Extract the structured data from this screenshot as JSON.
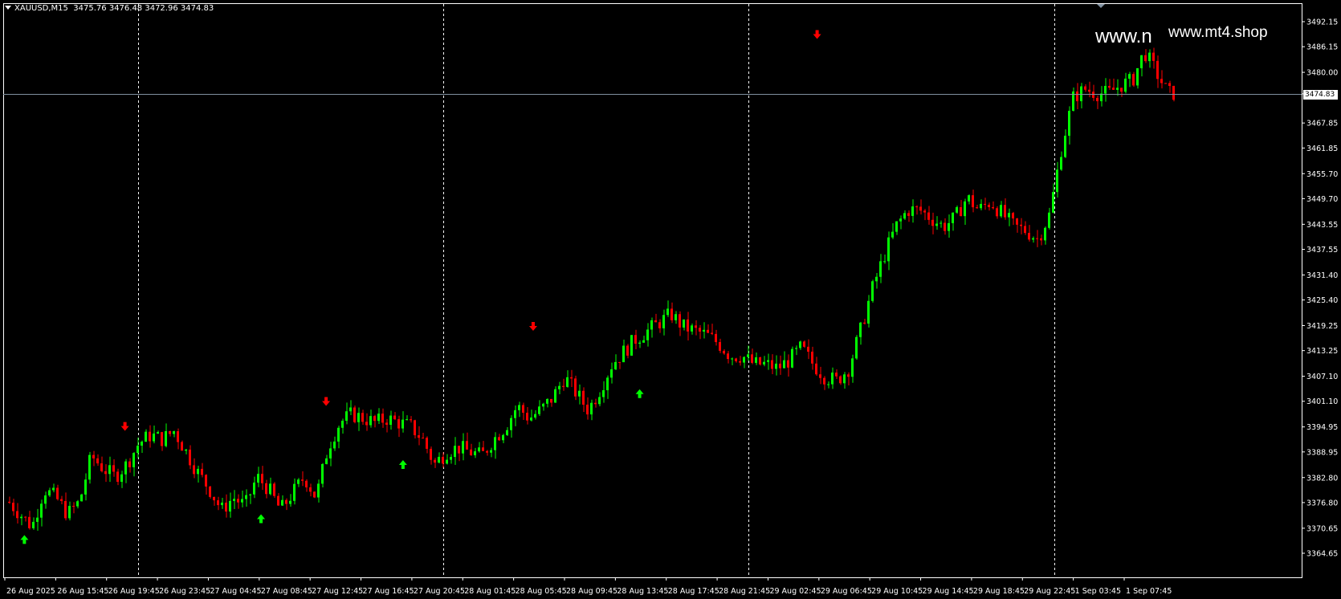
{
  "header": {
    "symbol_timeframe": "XAUUSD,M15",
    "ohlc": "3475.76 3476.48 3472.96 3474.83"
  },
  "watermark": {
    "large": "www.n",
    "small": "www.mt4.shop"
  },
  "current_price_label": "3474.83",
  "colors": {
    "background": "#000000",
    "frame": "#ffffff",
    "bull_candle": "#00ff00",
    "bear_candle": "#ff0000",
    "grid_separator": "#ffffff",
    "bid_line": "#8090a0",
    "buy_arrow": "#00ff00",
    "sell_arrow": "#ff0000"
  },
  "chart_data": {
    "type": "candlestick",
    "timeframe": "M15",
    "price_axis_labels": [
      "3492.15",
      "3486.15",
      "3480.00",
      "3474.83",
      "3467.85",
      "3461.85",
      "3455.70",
      "3449.70",
      "3443.55",
      "3437.55",
      "3431.40",
      "3425.40",
      "3419.25",
      "3413.25",
      "3407.10",
      "3401.10",
      "3394.95",
      "3388.95",
      "3382.80",
      "3376.80",
      "3370.65",
      "3364.65"
    ],
    "y_range": [
      3364.65,
      3492.15
    ],
    "time_axis_labels": [
      "26 Aug 2025",
      "26 Aug 15:45",
      "26 Aug 19:45",
      "26 Aug 23:45",
      "27 Aug 04:45",
      "27 Aug 08:45",
      "27 Aug 12:45",
      "27 Aug 16:45",
      "27 Aug 20:45",
      "28 Aug 01:45",
      "28 Aug 05:45",
      "28 Aug 09:45",
      "28 Aug 13:45",
      "28 Aug 17:45",
      "28 Aug 21:45",
      "29 Aug 02:45",
      "29 Aug 06:45",
      "29 Aug 10:45",
      "29 Aug 14:45",
      "29 Aug 18:45",
      "29 Aug 22:45",
      "1 Sep 03:45",
      "1 Sep 07:45"
    ],
    "day_separators": [
      3,
      9,
      15,
      21
    ],
    "close_path": [
      [
        0,
        3377
      ],
      [
        1,
        3374
      ],
      [
        2,
        3371
      ],
      [
        3,
        3380
      ],
      [
        4,
        3378
      ],
      [
        5,
        3374
      ],
      [
        6,
        3377
      ],
      [
        7,
        3388
      ],
      [
        8,
        3385
      ],
      [
        9,
        3383
      ],
      [
        10,
        3386
      ],
      [
        11,
        3391
      ],
      [
        12,
        3393
      ],
      [
        13,
        3392
      ],
      [
        14,
        3394
      ],
      [
        15,
        3389
      ],
      [
        16,
        3384
      ],
      [
        17,
        3380
      ],
      [
        18,
        3375
      ],
      [
        19,
        3378
      ],
      [
        20,
        3376
      ],
      [
        21,
        3383
      ],
      [
        22,
        3380
      ],
      [
        23,
        3375
      ],
      [
        24,
        3379
      ],
      [
        25,
        3383
      ],
      [
        26,
        3378
      ],
      [
        27,
        3390
      ],
      [
        28,
        3396
      ],
      [
        29,
        3398
      ],
      [
        30,
        3397
      ],
      [
        31,
        3396
      ],
      [
        32,
        3397
      ],
      [
        33,
        3396
      ],
      [
        34,
        3395
      ],
      [
        35,
        3392
      ],
      [
        36,
        3386
      ],
      [
        37,
        3389
      ],
      [
        38,
        3390
      ],
      [
        39,
        3389
      ],
      [
        40,
        3388
      ],
      [
        41,
        3392
      ],
      [
        42,
        3395
      ],
      [
        43,
        3400
      ],
      [
        44,
        3397
      ],
      [
        45,
        3399
      ],
      [
        46,
        3402
      ],
      [
        47,
        3407
      ],
      [
        48,
        3403
      ],
      [
        49,
        3399
      ],
      [
        50,
        3404
      ],
      [
        51,
        3410
      ],
      [
        52,
        3413
      ],
      [
        53,
        3416
      ],
      [
        54,
        3418
      ],
      [
        55,
        3420
      ],
      [
        56,
        3422
      ],
      [
        57,
        3419
      ],
      [
        58,
        3418
      ],
      [
        59,
        3417
      ],
      [
        60,
        3415
      ],
      [
        61,
        3412
      ],
      [
        62,
        3412
      ],
      [
        63,
        3410
      ],
      [
        64,
        3410
      ],
      [
        65,
        3409
      ],
      [
        66,
        3411
      ],
      [
        67,
        3414
      ],
      [
        68,
        3410
      ],
      [
        69,
        3407
      ],
      [
        70,
        3406
      ],
      [
        71,
        3409
      ],
      [
        72,
        3418
      ],
      [
        73,
        3428
      ],
      [
        74,
        3436
      ],
      [
        75,
        3443
      ],
      [
        76,
        3447
      ],
      [
        77,
        3447
      ],
      [
        78,
        3445
      ],
      [
        79,
        3443
      ],
      [
        80,
        3445
      ],
      [
        81,
        3450
      ],
      [
        82,
        3447
      ],
      [
        83,
        3449
      ],
      [
        84,
        3446
      ],
      [
        85,
        3443
      ],
      [
        86,
        3442
      ],
      [
        87,
        3440
      ],
      [
        88,
        3446
      ],
      [
        89,
        3462
      ],
      [
        90,
        3474
      ],
      [
        91,
        3476
      ],
      [
        92,
        3475
      ],
      [
        93,
        3475
      ],
      [
        94,
        3477
      ],
      [
        95,
        3478
      ],
      [
        96,
        3485
      ],
      [
        97,
        3480
      ],
      [
        98,
        3475
      ]
    ],
    "signals": [
      {
        "type": "buy",
        "index": 0.5,
        "price": 3369
      },
      {
        "type": "sell",
        "index": 9.0,
        "price": 3394
      },
      {
        "type": "buy",
        "index": 20.5,
        "price": 3374
      },
      {
        "type": "sell",
        "index": 26.0,
        "price": 3400
      },
      {
        "type": "buy",
        "index": 32.5,
        "price": 3387
      },
      {
        "type": "sell",
        "index": 43.5,
        "price": 3418
      },
      {
        "type": "buy",
        "index": 52.5,
        "price": 3404
      },
      {
        "type": "sell",
        "index": 67.5,
        "price": 3488
      }
    ],
    "bid_price": 3474.83,
    "grid": false
  }
}
